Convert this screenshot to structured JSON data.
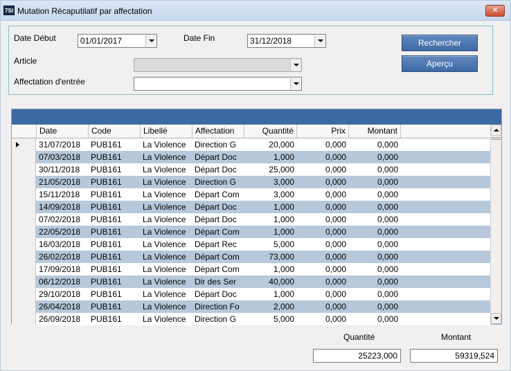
{
  "window": {
    "title": "Mutation Récaputilatif par affectation",
    "icon_text": "7SI",
    "close_glyph": "✕"
  },
  "filters": {
    "date_debut_label": "Date Début",
    "date_debut_value": "01/01/2017",
    "date_fin_label": "Date Fin",
    "date_fin_value": "31/12/2018",
    "article_label": "Article",
    "article_value": "",
    "affectation_label": "Affectation d'entrée",
    "affectation_value": ""
  },
  "buttons": {
    "rechercher": "Rechercher",
    "apercu": "Aperçu"
  },
  "grid": {
    "columns": [
      "Date",
      "Code",
      "Libellé",
      "Affectation",
      "Quantité",
      "Prix",
      "Montant"
    ],
    "rows": [
      [
        "31/07/2018",
        "PUB161",
        "La Violence",
        "Direction G",
        "20,000",
        "0,000",
        "0,000"
      ],
      [
        "07/03/2018",
        "PUB161",
        "La Violence",
        "Départ Doc",
        "1,000",
        "0,000",
        "0,000"
      ],
      [
        "30/11/2018",
        "PUB161",
        "La Violence",
        "Départ Doc",
        "25,000",
        "0,000",
        "0,000"
      ],
      [
        "21/05/2018",
        "PUB161",
        "La Violence",
        "Direction G",
        "3,000",
        "0,000",
        "0,000"
      ],
      [
        "15/11/2018",
        "PUB161",
        "La Violence",
        "Départ Com",
        "3,000",
        "0,000",
        "0,000"
      ],
      [
        "14/09/2018",
        "PUB161",
        "La Violence",
        "Départ Doc",
        "1,000",
        "0,000",
        "0,000"
      ],
      [
        "07/02/2018",
        "PUB161",
        "La Violence",
        "Départ Doc",
        "1,000",
        "0,000",
        "0,000"
      ],
      [
        "22/05/2018",
        "PUB161",
        "La Violence",
        "Départ Com",
        "1,000",
        "0,000",
        "0,000"
      ],
      [
        "16/03/2018",
        "PUB161",
        "La Violence",
        "Départ  Rec",
        "5,000",
        "0,000",
        "0,000"
      ],
      [
        "26/02/2018",
        "PUB161",
        "La Violence",
        "Départ Com",
        "73,000",
        "0,000",
        "0,000"
      ],
      [
        "17/09/2018",
        "PUB161",
        "La Violence",
        "Départ Com",
        "1,000",
        "0,000",
        "0,000"
      ],
      [
        "06/12/2018",
        "PUB161",
        "La Violence",
        "Dir des Ser",
        "40,000",
        "0,000",
        "0,000"
      ],
      [
        "29/10/2018",
        "PUB161",
        "La Violence",
        "Départ Doc",
        "1,000",
        "0,000",
        "0,000"
      ],
      [
        "26/04/2018",
        "PUB161",
        "La Violence",
        "Direction Fo",
        "2,000",
        "0,000",
        "0,000"
      ],
      [
        "26/09/2018",
        "PUB161",
        "La Violence",
        "Direction G",
        "5,000",
        "0,000",
        "0,000"
      ]
    ]
  },
  "totals": {
    "quantite_label": "Quantité",
    "quantite_value": "25223,000",
    "montant_label": "Montant",
    "montant_value": "59319,524"
  },
  "colors": {
    "accent": "#3e6aa3",
    "row_alt": "#b7c8db"
  }
}
